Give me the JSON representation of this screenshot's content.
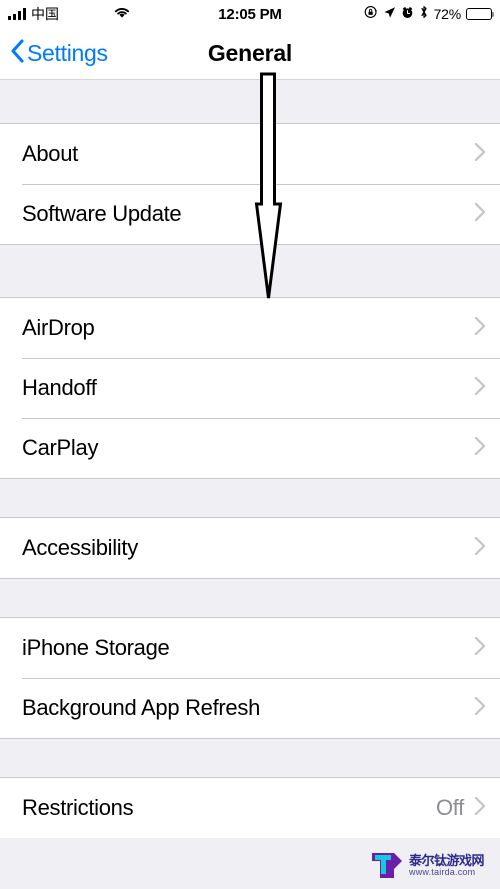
{
  "status_bar": {
    "carrier": "中国",
    "carrier_redacted": true,
    "signal_icon": "signal-bars-icon",
    "wifi_icon": "wifi-icon",
    "time": "12:05 PM",
    "rotation_lock_icon": "rotation-lock-icon",
    "location_icon": "location-arrow-icon",
    "alarm_icon": "alarm-clock-icon",
    "bluetooth_icon": "bluetooth-icon",
    "battery_percent": "72%",
    "battery_level": 72
  },
  "nav_bar": {
    "back_label": "Settings",
    "back_icon": "chevron-left-icon",
    "title": "General"
  },
  "colors": {
    "accent_blue": "#007AFF",
    "group_background": "#EFEFF4",
    "row_background": "#FFFFFF",
    "separator": "#C8C7CC",
    "chevron": "#C7C7CC",
    "value_text": "#8E8E93"
  },
  "sections": [
    {
      "rows": [
        {
          "label": "About",
          "value": "",
          "chevron": true
        },
        {
          "label": "Software Update",
          "value": "",
          "chevron": true
        }
      ]
    },
    {
      "rows": [
        {
          "label": "AirDrop",
          "value": "",
          "chevron": true
        },
        {
          "label": "Handoff",
          "value": "",
          "chevron": true
        },
        {
          "label": "CarPlay",
          "value": "",
          "chevron": true
        }
      ]
    },
    {
      "rows": [
        {
          "label": "Accessibility",
          "value": "",
          "chevron": true
        }
      ]
    },
    {
      "rows": [
        {
          "label": "iPhone Storage",
          "value": "",
          "chevron": true
        },
        {
          "label": "Background App Refresh",
          "value": "",
          "chevron": true
        }
      ]
    },
    {
      "rows": [
        {
          "label": "Restrictions",
          "value": "Off",
          "chevron": true
        }
      ]
    }
  ],
  "annotation": {
    "type": "down-arrow",
    "description": "hand-drawn downward pointing arrow overlay"
  },
  "watermark": {
    "logo_icon": "tairda-t-logo-icon",
    "site_name": "泰尔钛游戏网",
    "url": "www.tairda.com"
  }
}
